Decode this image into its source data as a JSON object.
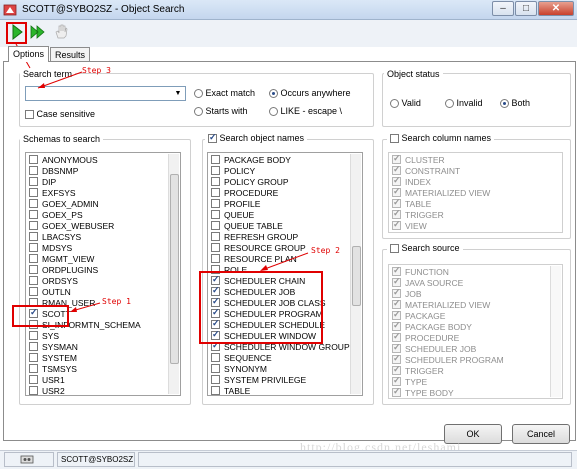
{
  "window": {
    "title": "SCOTT@SYBO2SZ - Object Search",
    "btn_min": "–",
    "btn_max": "□",
    "btn_close": "✕"
  },
  "toolbar": {
    "run": "run-icon",
    "run_all": "run-all-icon",
    "hand": "hand-icon"
  },
  "tabs": [
    "Options",
    "Results"
  ],
  "search_term": {
    "label": "Search term",
    "value": "",
    "case_label": "Case sensitive",
    "case_checked": false,
    "exact_match": "Exact match",
    "occurs_anywhere": "Occurs anywhere",
    "starts_with": "Starts with",
    "like_escape": "LIKE - escape \\",
    "selected": "Occurs anywhere"
  },
  "object_status": {
    "label": "Object status",
    "valid": "Valid",
    "invalid": "Invalid",
    "both": "Both",
    "selected": "Both"
  },
  "schemas": {
    "label": "Schemas to search",
    "items": [
      {
        "name": "ANONYMOUS",
        "checked": false
      },
      {
        "name": "DBSNMP",
        "checked": false
      },
      {
        "name": "DIP",
        "checked": false
      },
      {
        "name": "EXFSYS",
        "checked": false
      },
      {
        "name": "GOEX_ADMIN",
        "checked": false
      },
      {
        "name": "GOEX_PS",
        "checked": false
      },
      {
        "name": "GOEX_WEBUSER",
        "checked": false
      },
      {
        "name": "LBACSYS",
        "checked": false
      },
      {
        "name": "MDSYS",
        "checked": false
      },
      {
        "name": "MGMT_VIEW",
        "checked": false
      },
      {
        "name": "ORDPLUGINS",
        "checked": false
      },
      {
        "name": "ORDSYS",
        "checked": false
      },
      {
        "name": "OUTLN",
        "checked": false
      },
      {
        "name": "RMAN_USER",
        "checked": false
      },
      {
        "name": "SCOTT",
        "checked": true
      },
      {
        "name": "SI_INFORMTN_SCHEMA",
        "checked": false
      },
      {
        "name": "SYS",
        "checked": false
      },
      {
        "name": "SYSMAN",
        "checked": false
      },
      {
        "name": "SYSTEM",
        "checked": false
      },
      {
        "name": "TSMSYS",
        "checked": false
      },
      {
        "name": "USR1",
        "checked": false
      },
      {
        "name": "USR2",
        "checked": false
      }
    ]
  },
  "object_names": {
    "label": "Search object names",
    "checked": true,
    "items": [
      {
        "name": "PACKAGE BODY",
        "checked": false
      },
      {
        "name": "POLICY",
        "checked": false
      },
      {
        "name": "POLICY GROUP",
        "checked": false
      },
      {
        "name": "PROCEDURE",
        "checked": false
      },
      {
        "name": "PROFILE",
        "checked": false
      },
      {
        "name": "QUEUE",
        "checked": false
      },
      {
        "name": "QUEUE TABLE",
        "checked": false
      },
      {
        "name": "REFRESH GROUP",
        "checked": false
      },
      {
        "name": "RESOURCE GROUP",
        "checked": false
      },
      {
        "name": "RESOURCE PLAN",
        "checked": false
      },
      {
        "name": "ROLE",
        "checked": false
      },
      {
        "name": "SCHEDULER CHAIN",
        "checked": true
      },
      {
        "name": "SCHEDULER JOB",
        "checked": true
      },
      {
        "name": "SCHEDULER JOB CLASS",
        "checked": true
      },
      {
        "name": "SCHEDULER PROGRAM",
        "checked": true
      },
      {
        "name": "SCHEDULER SCHEDULE",
        "checked": true
      },
      {
        "name": "SCHEDULER WINDOW",
        "checked": true
      },
      {
        "name": "SCHEDULER WINDOW GROUP",
        "checked": true
      },
      {
        "name": "SEQUENCE",
        "checked": false
      },
      {
        "name": "SYNONYM",
        "checked": false
      },
      {
        "name": "SYSTEM PRIVILEGE",
        "checked": false
      },
      {
        "name": "TABLE",
        "checked": false
      }
    ]
  },
  "column_names": {
    "label": "Search column names",
    "checked": false,
    "items": [
      {
        "name": "CLUSTER",
        "checked": true
      },
      {
        "name": "CONSTRAINT",
        "checked": true
      },
      {
        "name": "INDEX",
        "checked": true
      },
      {
        "name": "MATERIALIZED VIEW",
        "checked": true
      },
      {
        "name": "TABLE",
        "checked": true
      },
      {
        "name": "TRIGGER",
        "checked": true
      },
      {
        "name": "VIEW",
        "checked": true
      }
    ]
  },
  "search_source": {
    "label": "Search source",
    "checked": false,
    "items": [
      {
        "name": "FUNCTION",
        "checked": true
      },
      {
        "name": "JAVA SOURCE",
        "checked": true
      },
      {
        "name": "JOB",
        "checked": true
      },
      {
        "name": "MATERIALIZED VIEW",
        "checked": true
      },
      {
        "name": "PACKAGE",
        "checked": true
      },
      {
        "name": "PACKAGE BODY",
        "checked": true
      },
      {
        "name": "PROCEDURE",
        "checked": true
      },
      {
        "name": "SCHEDULER JOB",
        "checked": true
      },
      {
        "name": "SCHEDULER PROGRAM",
        "checked": true
      },
      {
        "name": "TRIGGER",
        "checked": true
      },
      {
        "name": "TYPE",
        "checked": true
      },
      {
        "name": "TYPE BODY",
        "checked": true
      }
    ]
  },
  "annotations": {
    "step1": "Step 1",
    "step2": "Step 2",
    "step3": "Step 3",
    "color": "#e00000"
  },
  "buttons": {
    "ok": "OK",
    "cancel": "Cancel"
  },
  "status": {
    "icon": "connection-icon",
    "connection": "SCOTT@SYBO2SZ"
  },
  "watermark": "http://blog.csdn.net/leshami"
}
